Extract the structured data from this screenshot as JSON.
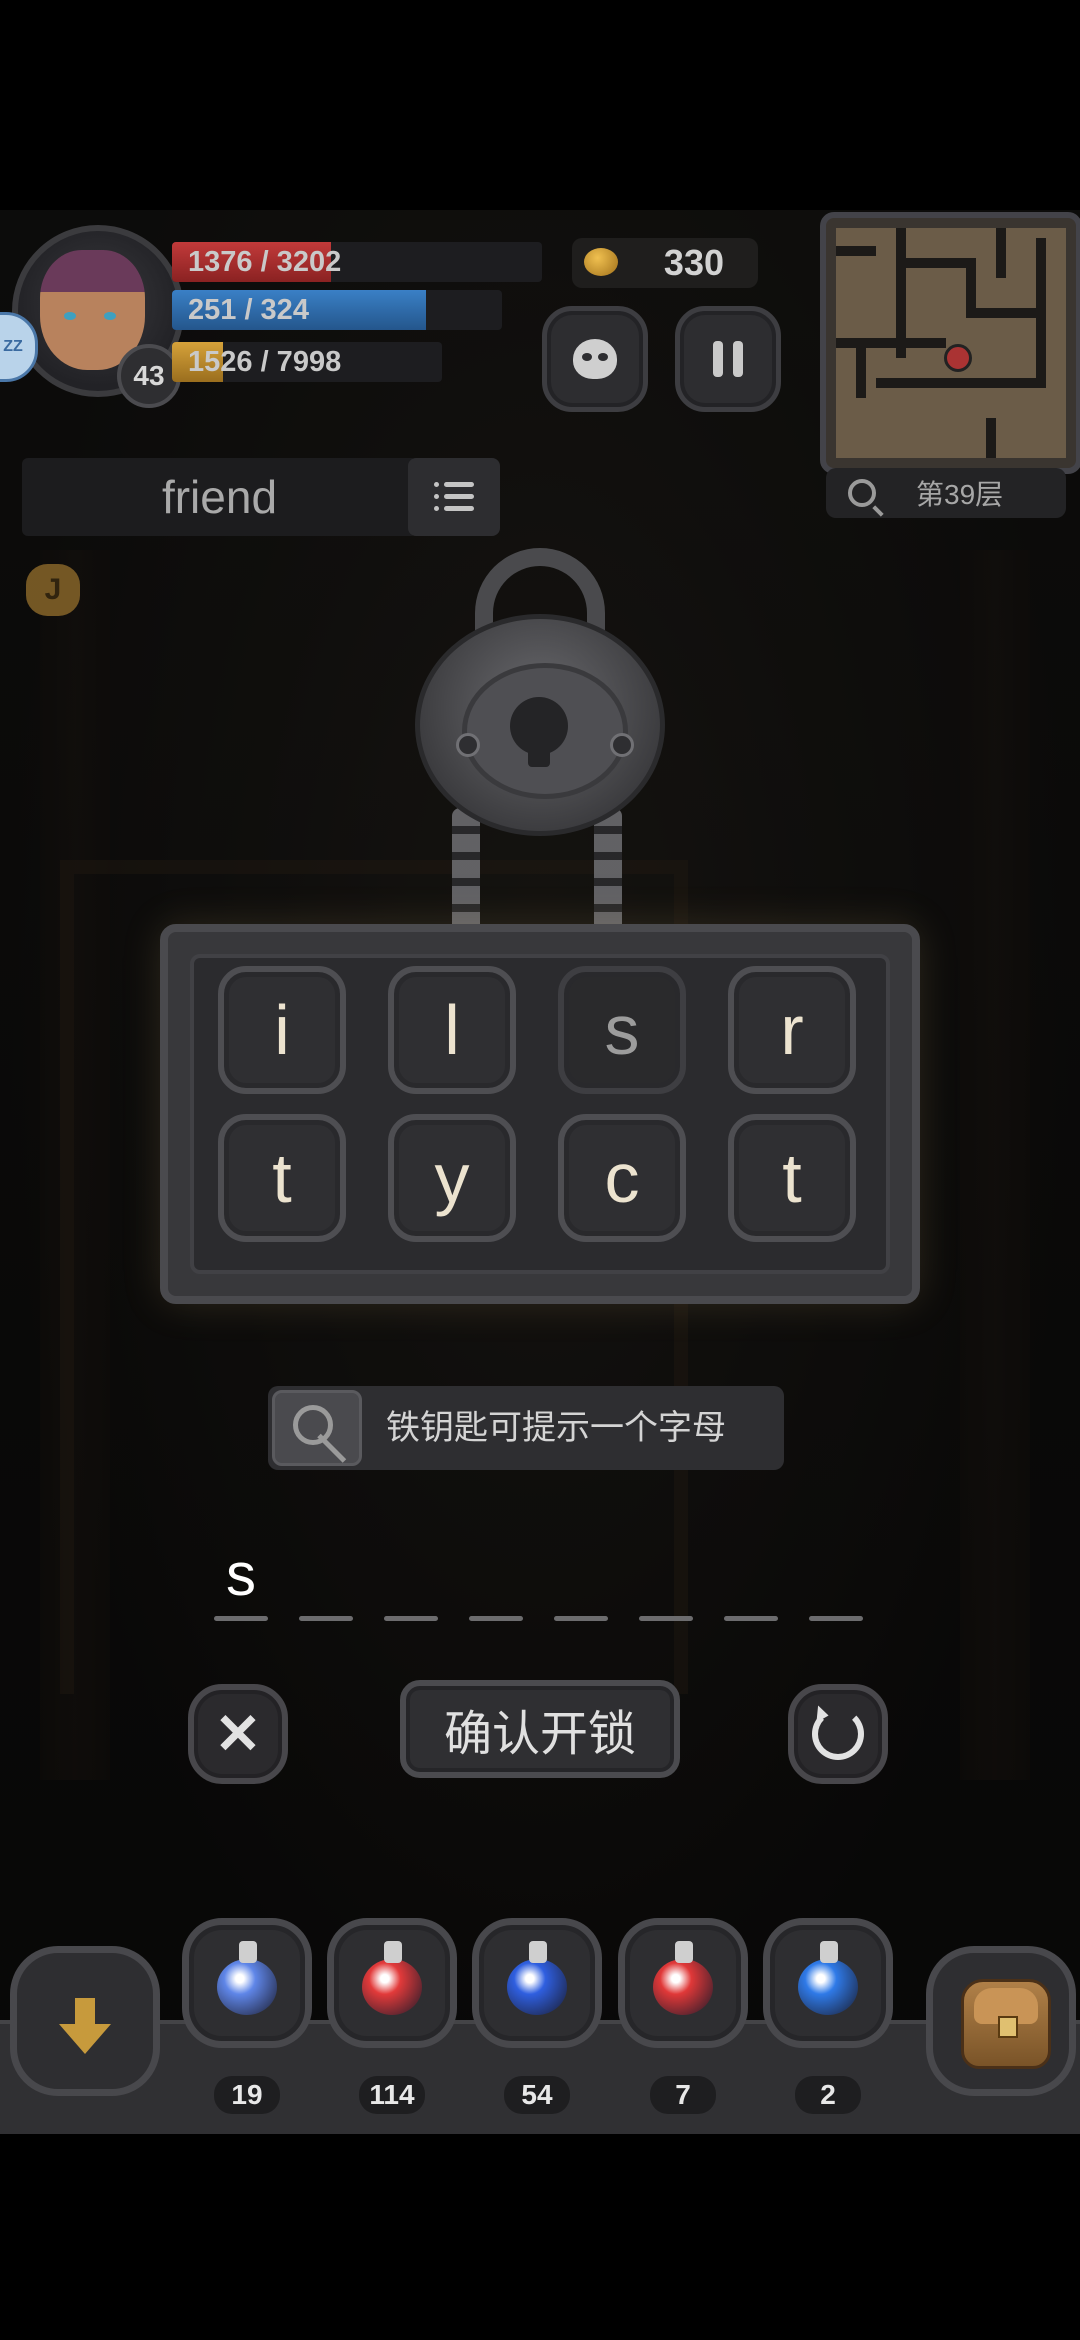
{
  "hud": {
    "level": "43",
    "sleep_label": "ZZ",
    "hp": {
      "text": "1376 / 3202",
      "fraction": 0.43
    },
    "mp": {
      "text": "251 / 324",
      "fraction": 0.77
    },
    "xp": {
      "text": "1526 / 7998",
      "fraction": 0.19
    },
    "coins": "330",
    "floor": "第39层"
  },
  "word_box": {
    "word": "friend"
  },
  "rune_label": "J",
  "letter_tiles": [
    {
      "letter": "i",
      "used": false
    },
    {
      "letter": "l",
      "used": false
    },
    {
      "letter": "s",
      "used": true
    },
    {
      "letter": "r",
      "used": false
    },
    {
      "letter": "t",
      "used": false
    },
    {
      "letter": "y",
      "used": false
    },
    {
      "letter": "c",
      "used": false
    },
    {
      "letter": "t",
      "used": false
    }
  ],
  "hint": {
    "text": "铁钥匙可提示一个字母"
  },
  "answer": {
    "letters": [
      "s",
      "",
      "",
      "",
      "",
      "",
      "",
      ""
    ]
  },
  "actions": {
    "confirm_label": "确认开锁"
  },
  "items": [
    {
      "name": "blue-flask-icon",
      "count": "19",
      "color": "#5f86e8"
    },
    {
      "name": "red-jar-icon",
      "count": "114",
      "color": "#e23a3a"
    },
    {
      "name": "blue-jar-icon",
      "count": "54",
      "color": "#2f5fe0"
    },
    {
      "name": "red-round-flask-icon",
      "count": "7",
      "color": "#e03838"
    },
    {
      "name": "blue-round-flask-icon",
      "count": "2",
      "color": "#2f7ae8"
    }
  ]
}
